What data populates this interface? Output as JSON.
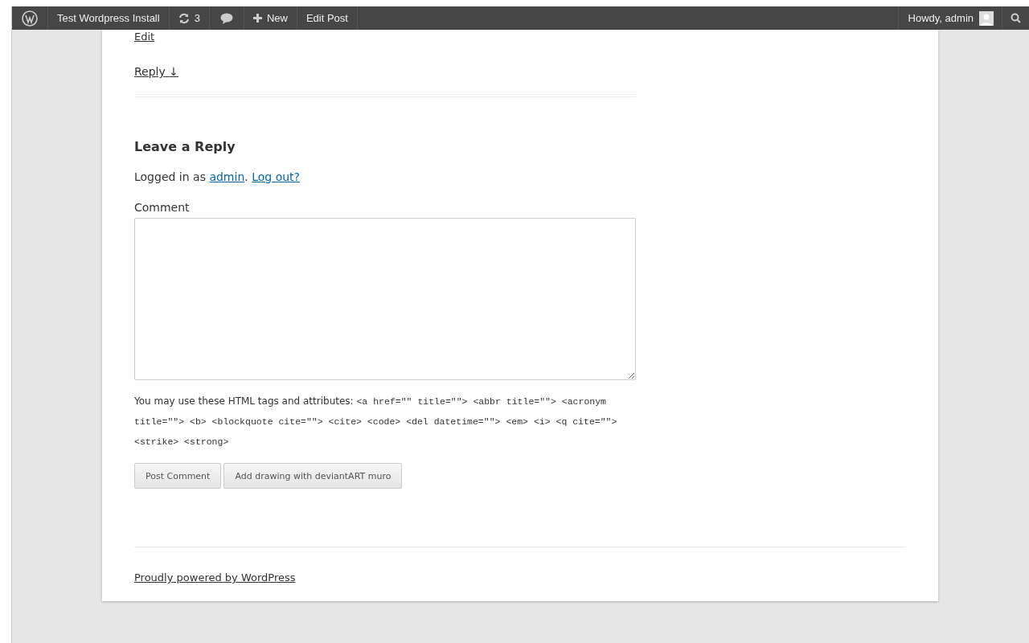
{
  "admin_bar": {
    "site": "Test Wordpress Install",
    "updates": "3",
    "new": "New",
    "edit_post": "Edit Post",
    "greeting": "Howdy, admin"
  },
  "comment_links": {
    "edit": "Edit",
    "reply": "Reply",
    "reply_arrow": "↓"
  },
  "reply_form": {
    "title": "Leave a Reply",
    "logged_in_prefix": "Logged in as",
    "user": "admin",
    "separator": ".",
    "logout": "Log out?",
    "comment_label": "Comment",
    "tags_intro": "You may use these HTML tags and attributes:",
    "tags": "<a href=\"\" title=\"\"> <abbr title=\"\"> <acronym title=\"\"> <b> <blockquote cite=\"\"> <cite> <code> <del datetime=\"\"> <em> <i> <q cite=\"\"> <strike> <strong>",
    "buttons": [
      "Post Comment",
      "Add drawing with deviantART muro"
    ]
  },
  "footer": {
    "credit": "Proudly powered by WordPress"
  }
}
